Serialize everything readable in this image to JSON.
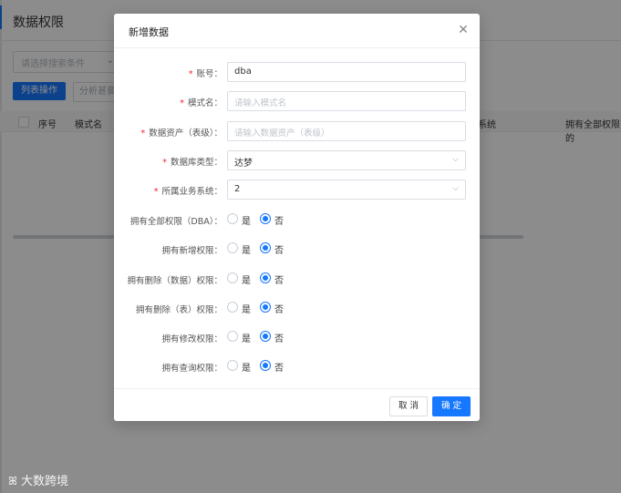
{
  "page": {
    "title": "数据权限",
    "filter_placeholder": "请选择搜索条件",
    "list_ops_button": "列表操作",
    "secondary_button": "分析甚要",
    "columns": [
      "序号",
      "模式名",
      "系统",
      "拥有全部权限的"
    ]
  },
  "modal": {
    "title": "新增数据",
    "fields": {
      "account": {
        "label": "账号：",
        "value": "dba",
        "required": true
      },
      "schema": {
        "label": "模式名：",
        "placeholder": "请输入模式名",
        "required": true
      },
      "asset": {
        "label": "数据资产（表级）：",
        "placeholder": "请输入数据资产（表级）",
        "required": true
      },
      "db_type": {
        "label": "数据库类型：",
        "value": "达梦",
        "required": true
      },
      "biz_system": {
        "label": "所属业务系统：",
        "value": "2",
        "required": true
      }
    },
    "radio_options": {
      "yes": "是",
      "no": "否"
    },
    "permissions": [
      {
        "label": "拥有全部权限（DBA）：",
        "selected": "no"
      },
      {
        "label": "拥有新增权限：",
        "selected": "no"
      },
      {
        "label": "拥有删除（数据）权限：",
        "selected": "no"
      },
      {
        "label": "拥有删除（表）权限：",
        "selected": "no"
      },
      {
        "label": "拥有修改权限：",
        "selected": "no"
      },
      {
        "label": "拥有查询权限：",
        "selected": "no"
      }
    ],
    "footer": {
      "cancel_label": "取 消",
      "ok_label": "确 定"
    }
  },
  "watermark": "大数跨境",
  "colors": {
    "primary": "#1677ff",
    "required": "#f5222d"
  },
  "icons": {
    "close": "close-icon",
    "chevron": "chevron-down-icon"
  }
}
